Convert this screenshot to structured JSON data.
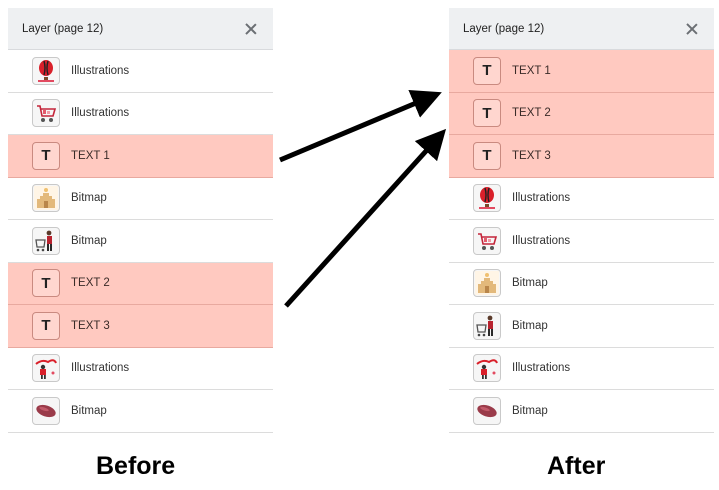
{
  "before": {
    "caption": "Before",
    "panel_title": "Layer (page 12)",
    "layers": [
      {
        "label": "Illustrations",
        "icon": "balloon-illustration-icon",
        "highlight": false
      },
      {
        "label": "Illustrations",
        "icon": "shopping-cart-illustration-icon",
        "highlight": false
      },
      {
        "label": "TEXT 1",
        "icon": "text-T",
        "glyph": "T",
        "highlight": true
      },
      {
        "label": "Bitmap",
        "icon": "sandcastle-bitmap-icon",
        "highlight": false
      },
      {
        "label": "Bitmap",
        "icon": "shopper-bitmap-icon",
        "highlight": false
      },
      {
        "label": "TEXT 2",
        "icon": "text-T",
        "glyph": "T",
        "highlight": true
      },
      {
        "label": "TEXT 3",
        "icon": "text-T",
        "glyph": "T",
        "highlight": true
      },
      {
        "label": "Illustrations",
        "icon": "person-splash-illustration-icon",
        "highlight": false
      },
      {
        "label": "Bitmap",
        "icon": "sweet-potato-bitmap-icon",
        "highlight": false
      }
    ]
  },
  "after": {
    "caption": "After",
    "panel_title": "Layer (page 12)",
    "layers": [
      {
        "label": "TEXT 1",
        "icon": "text-T",
        "glyph": "T",
        "highlight": true
      },
      {
        "label": "TEXT 2",
        "icon": "text-T",
        "glyph": "T",
        "highlight": true
      },
      {
        "label": "TEXT 3",
        "icon": "text-T",
        "glyph": "T",
        "highlight": true
      },
      {
        "label": "Illustrations",
        "icon": "balloon-illustration-icon",
        "highlight": false
      },
      {
        "label": "Illustrations",
        "icon": "shopping-cart-illustration-icon",
        "highlight": false
      },
      {
        "label": "Bitmap",
        "icon": "sandcastle-bitmap-icon",
        "highlight": false
      },
      {
        "label": "Bitmap",
        "icon": "shopper-bitmap-icon",
        "highlight": false
      },
      {
        "label": "Illustrations",
        "icon": "person-splash-illustration-icon",
        "highlight": false
      },
      {
        "label": "Bitmap",
        "icon": "sweet-potato-bitmap-icon",
        "highlight": false
      }
    ]
  },
  "colors": {
    "highlight": "#ffc9c0",
    "header_bg": "#eef0f2",
    "arrow": "#000000"
  }
}
